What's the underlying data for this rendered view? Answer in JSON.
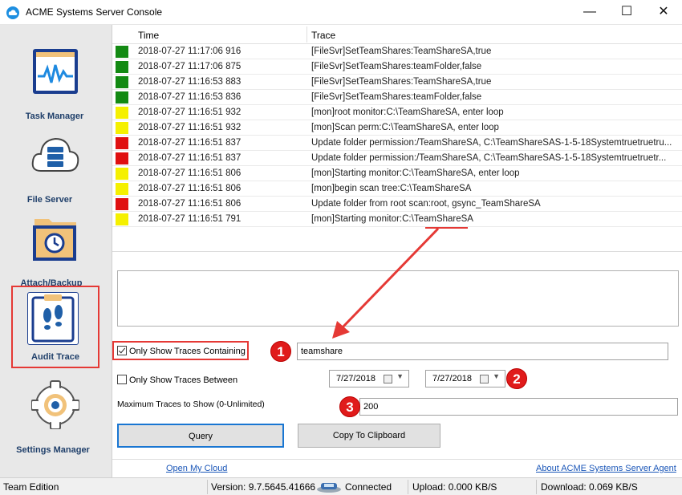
{
  "window": {
    "title": "ACME Systems Server Console",
    "minimize": "—",
    "maximize": "☐",
    "close": "✕"
  },
  "sidebar": {
    "items": [
      {
        "label": "Task Manager"
      },
      {
        "label": "File Server"
      },
      {
        "label": "Attach/Backup"
      },
      {
        "label": "Audit Trace",
        "active": true
      },
      {
        "label": "Settings Manager"
      }
    ]
  },
  "grid": {
    "columns": [
      "Time",
      "Trace"
    ],
    "status_colors": {
      "green": "#138a13",
      "yellow": "#f5f000",
      "red": "#e01010"
    },
    "rows": [
      {
        "status": "green",
        "time": "2018-07-27 11:17:06 916",
        "trace": "[FileSvr]SetTeamShares:TeamShareSA,true"
      },
      {
        "status": "green",
        "time": "2018-07-27 11:17:06 875",
        "trace": "[FileSvr]SetTeamShares:teamFolder,false"
      },
      {
        "status": "green",
        "time": "2018-07-27 11:16:53 883",
        "trace": "[FileSvr]SetTeamShares:TeamShareSA,true"
      },
      {
        "status": "green",
        "time": "2018-07-27 11:16:53 836",
        "trace": "[FileSvr]SetTeamShares:teamFolder,false"
      },
      {
        "status": "yellow",
        "time": "2018-07-27 11:16:51 932",
        "trace": "[mon]root monitor:C:\\TeamShareSA, enter loop"
      },
      {
        "status": "yellow",
        "time": "2018-07-27 11:16:51 932",
        "trace": "[mon]Scan perm:C:\\TeamShareSA, enter loop"
      },
      {
        "status": "red",
        "time": "2018-07-27 11:16:51 837",
        "trace": "Update folder permission:/TeamShareSA, C:\\TeamShareSAS-1-5-18Systemtruetruetru..."
      },
      {
        "status": "red",
        "time": "2018-07-27 11:16:51 837",
        "trace": "Update folder permission:/TeamShareSA, C:\\TeamShareSAS-1-5-18Systemtruetruetr..."
      },
      {
        "status": "yellow",
        "time": "2018-07-27 11:16:51 806",
        "trace": "[mon]Starting monitor:C:\\TeamShareSA, enter loop"
      },
      {
        "status": "yellow",
        "time": "2018-07-27 11:16:51 806",
        "trace": "[mon]begin scan tree:C:\\TeamShareSA"
      },
      {
        "status": "red",
        "time": "2018-07-27 11:16:51 806",
        "trace": "Update folder from root scan:root, gsync_TeamShareSA"
      },
      {
        "status": "yellow",
        "time": "2018-07-27 11:16:51 791",
        "trace": "[mon]Starting monitor:C:\\TeamShareSA"
      }
    ]
  },
  "filters": {
    "only_containing_label": "Only Show Traces Containing",
    "only_containing_checked": true,
    "contains_value": "teamshare",
    "only_between_label": "Only Show Traces Between",
    "only_between_checked": false,
    "date_from": "7/27/2018",
    "date_to": "7/27/2018",
    "max_label": "Maximum Traces to Show (0-Unlimited)",
    "max_value": "200"
  },
  "buttons": {
    "query": "Query",
    "copy": "Copy To Clipboard"
  },
  "callouts": [
    "1",
    "2",
    "3"
  ],
  "links": {
    "open_cloud": "Open My Cloud",
    "about": "About ACME Systems Server Agent"
  },
  "status": {
    "edition": "Team Edition",
    "version": "Version: 9.7.5645.41666",
    "connection": "Connected",
    "upload": "Upload: 0.000 KB/S",
    "download": "Download: 0.069 KB/S"
  },
  "accent": {
    "annotation_red": "#e53935",
    "link_blue": "#1a56b8",
    "focus_blue": "#1976d2"
  }
}
